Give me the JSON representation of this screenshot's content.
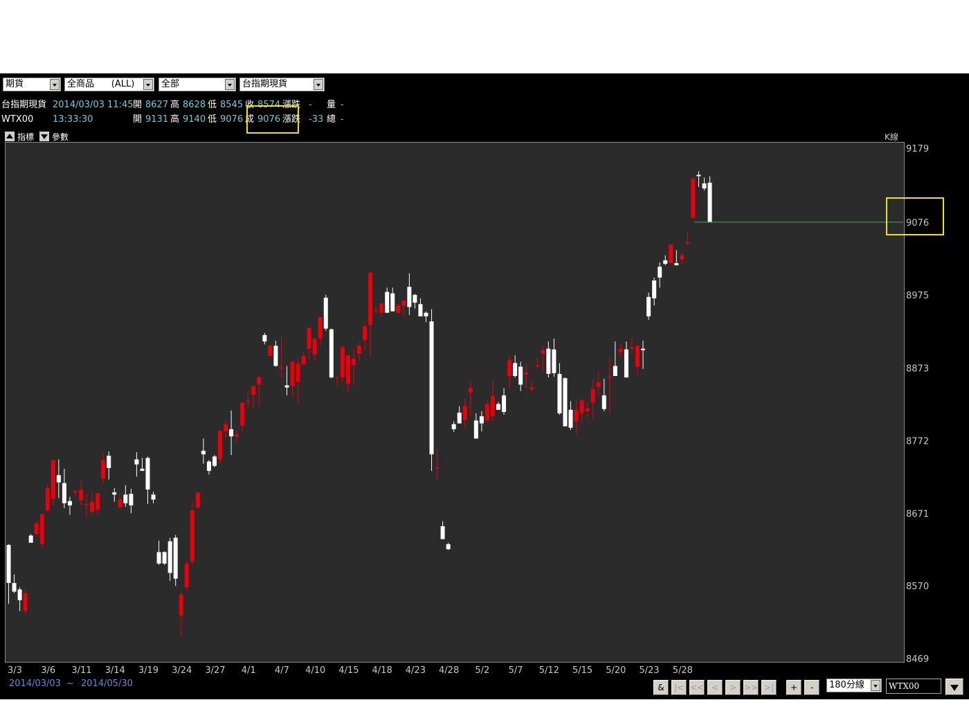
{
  "toolbar": {
    "market": "期貨",
    "product": "全商品      (ALL)",
    "scope": "全部",
    "symbol": "台指期現貨"
  },
  "quote1": {
    "name": "台指期現貨",
    "datetime": "2014/03/03 11:45",
    "open_label": "開",
    "open": "8627",
    "high_label": "高",
    "high": "8628",
    "low_label": "低",
    "low": "8545",
    "close_label": "收",
    "close": "8574",
    "change_label": "漲跌",
    "change": "-",
    "vol_label": "量",
    "vol": "-"
  },
  "quote2": {
    "name": "WTX00",
    "time": "13:33:30",
    "open_label": "開",
    "open": "9131",
    "high_label": "高",
    "high": "9140",
    "low_label": "低",
    "low": "9076",
    "close_label": "成",
    "close": "9076",
    "change_label": "漲跌",
    "change": "-33",
    "vol_label": "總",
    "vol": "-"
  },
  "tabs": {
    "indicator": "指標",
    "params": "參數",
    "kline": "K線"
  },
  "price_marker": "9076",
  "date_range": {
    "start": "2014/03/03",
    "sep": "~",
    "end": "2014/05/30"
  },
  "nav": {
    "amp": "&",
    "first": "|<",
    "prev_page": "<<",
    "prev": "<",
    "next": ">",
    "next_page": ">>",
    "last": ">|",
    "zoom_in": "+",
    "zoom_out": "-"
  },
  "period_select": "180分線",
  "symbol_input": "WTX00",
  "colors": {
    "up": "#e8000b",
    "down": "#ffffff",
    "plot_bg": "#2b2b2b",
    "app_bg": "#000000",
    "highlight": "#f2e600",
    "last_line": "#3cb44b"
  },
  "chart_data": {
    "type": "candlestick",
    "ylim": [
      8469,
      9179
    ],
    "yticks": [
      9179,
      9076,
      8975,
      8873,
      8772,
      8671,
      8570,
      8469
    ],
    "xticks": [
      {
        "i": 1,
        "label": "3/3"
      },
      {
        "i": 7,
        "label": "3/6"
      },
      {
        "i": 13,
        "label": "3/11"
      },
      {
        "i": 19,
        "label": "3/14"
      },
      {
        "i": 25,
        "label": "3/19"
      },
      {
        "i": 31,
        "label": "3/24"
      },
      {
        "i": 37,
        "label": "3/27"
      },
      {
        "i": 43,
        "label": "4/1"
      },
      {
        "i": 49,
        "label": "4/7"
      },
      {
        "i": 55,
        "label": "4/10"
      },
      {
        "i": 61,
        "label": "4/15"
      },
      {
        "i": 67,
        "label": "4/18"
      },
      {
        "i": 73,
        "label": "4/23"
      },
      {
        "i": 79,
        "label": "4/28"
      },
      {
        "i": 85,
        "label": "5/2"
      },
      {
        "i": 91,
        "label": "5/7"
      },
      {
        "i": 97,
        "label": "5/12"
      },
      {
        "i": 103,
        "label": "5/15"
      },
      {
        "i": 109,
        "label": "5/20"
      },
      {
        "i": 115,
        "label": "5/23"
      },
      {
        "i": 121,
        "label": "5/28"
      }
    ],
    "last_price": 9076,
    "candles": [
      [
        8627,
        8628,
        8545,
        8574
      ],
      [
        8574,
        8586,
        8560,
        8562
      ],
      [
        8565,
        8568,
        8535,
        8550
      ],
      [
        8535,
        8565,
        8530,
        8560
      ],
      [
        8640,
        8642,
        8630,
        8630
      ],
      [
        8642,
        8661,
        8640,
        8657
      ],
      [
        8628,
        8659,
        8624,
        8670
      ],
      [
        8675,
        8710,
        8672,
        8706
      ],
      [
        8691,
        8744,
        8681,
        8745
      ],
      [
        8724,
        8746,
        8692,
        8714
      ],
      [
        8713,
        8733,
        8678,
        8685
      ],
      [
        8688,
        8694,
        8669,
        8682
      ],
      [
        8700,
        8703,
        8694,
        8702
      ],
      [
        8689,
        8717,
        8682,
        8704
      ],
      [
        8683,
        8697,
        8665,
        8684
      ],
      [
        8673,
        8700,
        8671,
        8687
      ],
      [
        8676,
        8694,
        8668,
        8699
      ],
      [
        8719,
        8755,
        8714,
        8745
      ],
      [
        8751,
        8757,
        8718,
        8734
      ],
      [
        8700,
        8706,
        8687,
        8697
      ],
      [
        8679,
        8698,
        8679,
        8690
      ],
      [
        8697,
        8710,
        8680,
        8685
      ],
      [
        8698,
        8705,
        8671,
        8682
      ],
      [
        8746,
        8756,
        8722,
        8739
      ],
      [
        8733,
        8748,
        8730,
        8730
      ],
      [
        8748,
        8750,
        8684,
        8704
      ],
      [
        8697,
        8701,
        8685,
        8690
      ],
      [
        8617,
        8633,
        8599,
        8601
      ],
      [
        8617,
        8618,
        8599,
        8601
      ],
      [
        8632,
        8637,
        8577,
        8588
      ],
      [
        8637,
        8641,
        8570,
        8580
      ],
      [
        8529,
        8562,
        8500,
        8558
      ],
      [
        8568,
        8605,
        8563,
        8601
      ],
      [
        8604,
        8687,
        8600,
        8675
      ],
      [
        8679,
        8697,
        8677,
        8700
      ],
      [
        8758,
        8775,
        8740,
        8753
      ],
      [
        8743,
        8745,
        8725,
        8730
      ],
      [
        8750,
        8752,
        8735,
        8737
      ],
      [
        8746,
        8782,
        8740,
        8786
      ],
      [
        8785,
        8800,
        8777,
        8795
      ],
      [
        8788,
        8814,
        8752,
        8778
      ],
      [
        8778,
        8787,
        8770,
        8781
      ],
      [
        8793,
        8826,
        8785,
        8825
      ],
      [
        8828,
        8842,
        8819,
        8828
      ],
      [
        8836,
        8848,
        8817,
        8848
      ],
      [
        8850,
        8864,
        8820,
        8860
      ],
      [
        8919,
        8922,
        8906,
        8910
      ],
      [
        8890,
        8905,
        8891,
        8904
      ],
      [
        8904,
        8911,
        8875,
        8876
      ],
      [
        8874,
        8917,
        8860,
        8874
      ],
      [
        8849,
        8876,
        8835,
        8846
      ],
      [
        8848,
        8865,
        8832,
        8882
      ],
      [
        8854,
        8888,
        8825,
        8879
      ],
      [
        8878,
        8896,
        8878,
        8890
      ],
      [
        8900,
        8929,
        8886,
        8929
      ],
      [
        8892,
        8912,
        8883,
        8914
      ],
      [
        8914,
        8934,
        8905,
        8944
      ],
      [
        8971,
        8975,
        8925,
        8928
      ],
      [
        8927,
        8928,
        8859,
        8860
      ],
      [
        8860,
        8862,
        8849,
        8860
      ],
      [
        8860,
        8904,
        8853,
        8902
      ],
      [
        8851,
        8886,
        8840,
        8891
      ],
      [
        8877,
        8900,
        8849,
        8886
      ],
      [
        8893,
        8908,
        8883,
        8904
      ],
      [
        8912,
        8937,
        8898,
        8931
      ],
      [
        8933,
        8973,
        8889,
        9006
      ],
      [
        8954,
        8959,
        8948,
        8954
      ],
      [
        8950,
        8963,
        8944,
        8963
      ],
      [
        8979,
        8985,
        8958,
        8950
      ],
      [
        8977,
        8985,
        8956,
        8952
      ],
      [
        8950,
        8962,
        8948,
        8960
      ],
      [
        8960,
        8965,
        8945,
        8967
      ],
      [
        8986,
        9005,
        8947,
        8958
      ],
      [
        8975,
        8976,
        8956,
        8964
      ],
      [
        8962,
        8970,
        8948,
        8945
      ],
      [
        8950,
        8952,
        8937,
        8945
      ],
      [
        8938,
        8955,
        8730,
        8753
      ],
      [
        8735,
        8760,
        8718,
        8735
      ],
      [
        8653,
        8660,
        8640,
        8635
      ],
      [
        8628,
        8630,
        8620,
        8621
      ],
      [
        8795,
        8799,
        8784,
        8788
      ],
      [
        8811,
        8820,
        8800,
        8796
      ],
      [
        8801,
        8831,
        8790,
        8820
      ],
      [
        8839,
        8854,
        8807,
        8845
      ],
      [
        8800,
        8810,
        8810,
        8775
      ],
      [
        8806,
        8813,
        8785,
        8796
      ],
      [
        8800,
        8828,
        8801,
        8823
      ],
      [
        8806,
        8856,
        8799,
        8834
      ],
      [
        8823,
        8826,
        8822,
        8815
      ],
      [
        8835,
        8845,
        8808,
        8812
      ],
      [
        8862,
        8890,
        8845,
        8884
      ],
      [
        8880,
        8891,
        8860,
        8862
      ],
      [
        8875,
        8882,
        8841,
        8850
      ],
      [
        8864,
        8880,
        8845,
        8867
      ],
      [
        8843,
        8854,
        8840,
        8846
      ],
      [
        8875,
        8888,
        8873,
        8877
      ],
      [
        8893,
        8905,
        8869,
        8898
      ],
      [
        8900,
        8910,
        8860,
        8865
      ],
      [
        8899,
        8914,
        8861,
        8866
      ],
      [
        8865,
        8880,
        8808,
        8810
      ],
      [
        8859,
        8860,
        8826,
        8792
      ],
      [
        8815,
        8827,
        8787,
        8790
      ],
      [
        8799,
        8829,
        8781,
        8815
      ],
      [
        8810,
        8831,
        8797,
        8828
      ],
      [
        8813,
        8826,
        8804,
        8817
      ],
      [
        8825,
        8857,
        8803,
        8844
      ],
      [
        8847,
        8870,
        8835,
        8853
      ],
      [
        8835,
        8858,
        8813,
        8816
      ],
      [
        8860,
        8887,
        8810,
        8861
      ],
      [
        8876,
        8910,
        8870,
        8862
      ],
      [
        8895,
        8908,
        8887,
        8900
      ],
      [
        8899,
        8910,
        8873,
        8860
      ],
      [
        8900,
        8915,
        8892,
        8902
      ],
      [
        8875,
        8905,
        8864,
        8904
      ],
      [
        8900,
        8911,
        8872,
        8898
      ],
      [
        8972,
        8978,
        8940,
        8945
      ],
      [
        8995,
        8999,
        8960,
        8970
      ],
      [
        9014,
        9020,
        8985,
        8999
      ],
      [
        9023,
        9030,
        9016,
        9018
      ],
      [
        9019,
        9043,
        9024,
        9045
      ],
      [
        9019,
        9037,
        9019,
        9016
      ],
      [
        9024,
        9033,
        9017,
        9030
      ],
      [
        9048,
        9063,
        9043,
        9048
      ],
      [
        9082,
        9117,
        9080,
        9137
      ],
      [
        9142,
        9147,
        9125,
        9140
      ],
      [
        9130,
        9138,
        9120,
        9123
      ],
      [
        9131,
        9140,
        9076,
        9076
      ]
    ]
  }
}
